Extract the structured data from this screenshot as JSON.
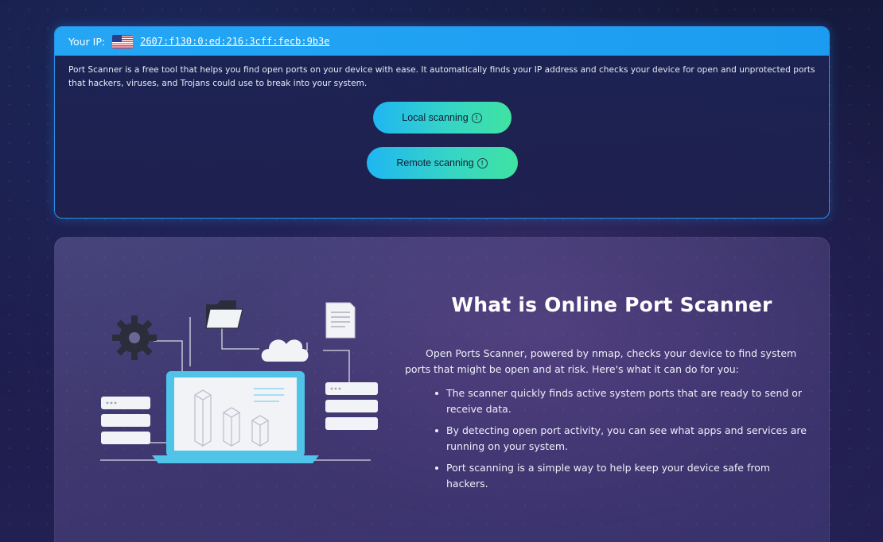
{
  "ip_bar": {
    "label": "Your IP:",
    "ip_address": "2607:f130:0:ed:216:3cff:fecb:9b3e",
    "flag_icon": "us-flag-icon"
  },
  "intro": {
    "text": "Port Scanner is a free tool that helps you find open ports on your device with ease. It automatically finds your IP address and checks your device for open and unprotected ports that hackers, viruses, and Trojans could use to break into your system."
  },
  "buttons": {
    "local": {
      "label": "Local scanning",
      "icon": "info-icon",
      "icon_glyph": "!"
    },
    "remote": {
      "label": "Remote scanning",
      "icon": "info-icon",
      "icon_glyph": "!"
    }
  },
  "about": {
    "title": "What is Online Port Scanner",
    "intro": "Open Ports Scanner, powered by nmap, checks your device to find system ports that might be open and at risk. Here's what it can do for you:",
    "bullets": [
      "The scanner quickly finds active system ports that are ready to send or receive data.",
      "By detecting open port activity, you can see what apps and services are running on your system.",
      "Port scanning is a simple way to help keep your device safe from hackers."
    ]
  },
  "colors": {
    "ip_bar": "#24a6f5",
    "card_border": "#2a8fe6",
    "button_start": "#1fb6f2",
    "button_end": "#40e3a2",
    "laptop_accent": "#4fc3e8"
  }
}
